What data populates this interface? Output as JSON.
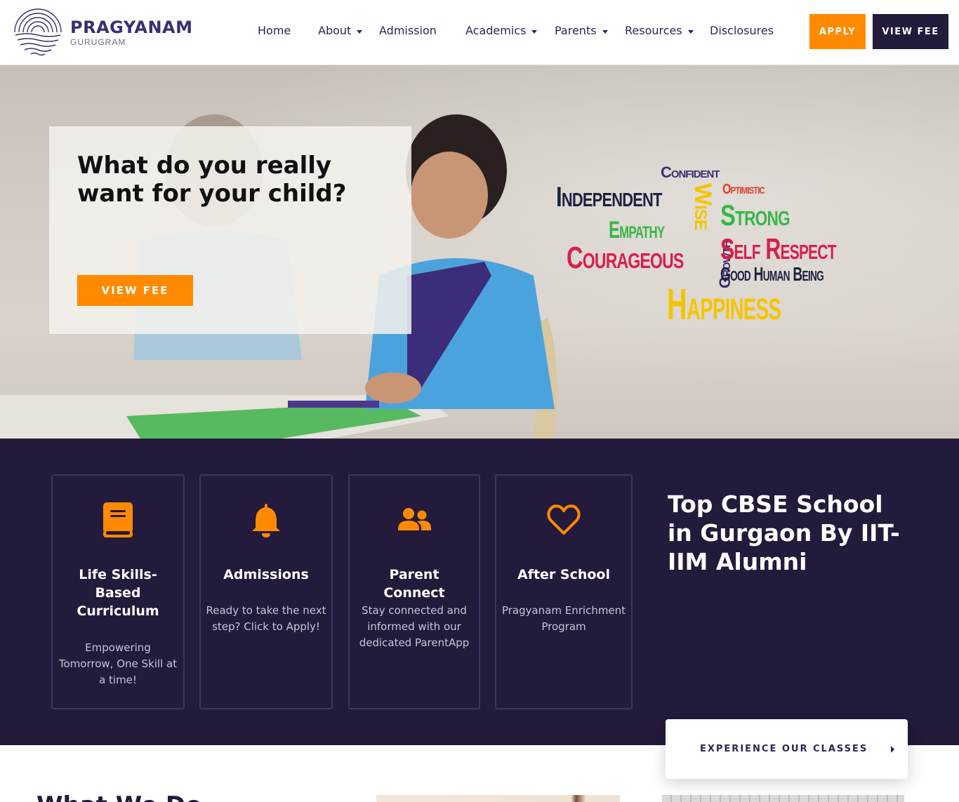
{
  "brand": {
    "name": "PRAGYANAM",
    "sub": "GURUGRAM",
    "color": "#3b2e73"
  },
  "nav": {
    "items": [
      {
        "label": "Home",
        "dropdown": false
      },
      {
        "label": "About",
        "dropdown": true
      },
      {
        "label": "Admission",
        "dropdown": false
      },
      {
        "label": "Academics",
        "dropdown": true
      },
      {
        "label": "Parents",
        "dropdown": true
      },
      {
        "label": "Resources",
        "dropdown": true
      },
      {
        "label": "Disclosures",
        "dropdown": false
      }
    ],
    "apply_label": "APPLY",
    "view_fee_label": "VIEW FEE"
  },
  "hero": {
    "title": "What do you really want for your child?",
    "button_label": "VIEW FEE",
    "words": {
      "confident": "Confident",
      "independent": "Independent",
      "optimistic": "Optimistic",
      "wise": "Wise",
      "strong": "Strong",
      "empathy": "Empathy",
      "courageous": "Courageous",
      "growth": "Growth",
      "self_respect": "Self Respect",
      "good_human_being": "Good Human Being",
      "happiness": "Happiness"
    }
  },
  "features": {
    "cards": [
      {
        "icon": "book-icon",
        "title": "Life Skills-Based Curriculum",
        "description": "Empowering Tomorrow, One Skill at a time!"
      },
      {
        "icon": "bell-icon",
        "title": "Admissions",
        "description": "Ready to take the next step? Click to Apply!"
      },
      {
        "icon": "users-icon",
        "title": "Parent Connect",
        "description": "Stay connected and informed with our dedicated ParentApp"
      },
      {
        "icon": "heart-icon",
        "title": "After School",
        "description": "Pragyanam Enrichment Program"
      }
    ],
    "heading": "Top CBSE School in Gurgaon By IIT-IIM Alumni",
    "experience_label": "EXPERIENCE OUR CLASSES"
  },
  "below": {
    "heading": "What We Do"
  },
  "colors": {
    "accent": "#ff8a00",
    "dark": "#231a3c",
    "card_border": "#3e3462",
    "text_dark": "#2b2456"
  }
}
